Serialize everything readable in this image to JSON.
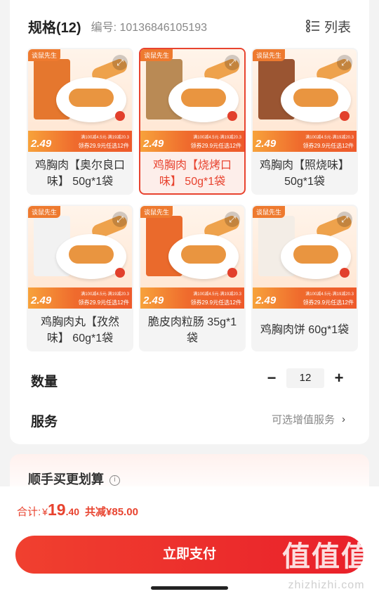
{
  "spec": {
    "title": "规格(12)",
    "code": "编号: 10136846105193",
    "list_label": "列表"
  },
  "skus": [
    {
      "brand": "谈鼠先生",
      "price": "2.49",
      "promo1": "满100减4.5元·满19减20.3",
      "promo2": "领券29.9元任选12件",
      "name": "鸡胸肉【奥尔良口味】 50g*1袋",
      "pack_color": "#e5772e",
      "selected": false
    },
    {
      "brand": "谈鼠先生",
      "price": "2.49",
      "promo1": "满100减4.5元·满19减20.3",
      "promo2": "领券29.9元任选12件",
      "name": "鸡胸肉【烧烤口味】 50g*1袋",
      "pack_color": "#b98a55",
      "selected": true
    },
    {
      "brand": "谈鼠先生",
      "price": "2.49",
      "promo1": "满100减4.5元·满19减20.3",
      "promo2": "领券29.9元任选12件",
      "name": "鸡胸肉【照烧味】 50g*1袋",
      "pack_color": "#9a5532",
      "selected": false
    },
    {
      "brand": "谈鼠先生",
      "price": "2.49",
      "promo1": "满100减4.5元·满19减20.3",
      "promo2": "领券29.9元任选12件",
      "name": "鸡胸肉丸【孜然味】 60g*1袋",
      "pack_color": "#f2f2f2",
      "selected": false
    },
    {
      "brand": "谈鼠先生",
      "price": "2.49",
      "promo1": "满100减4.5元·满19减20.3",
      "promo2": "领券29.9元任选12件",
      "name": "脆皮肉粒肠 35g*1袋",
      "pack_color": "#ea6a2c",
      "selected": false
    },
    {
      "brand": "谈鼠先生",
      "price": "2.49",
      "promo1": "满100减4.5元·满19减20.3",
      "promo2": "领券29.9元任选12件",
      "name": "鸡胸肉饼 60g*1袋",
      "pack_color": "#f3ede6",
      "selected": false
    }
  ],
  "quantity": {
    "label": "数量",
    "value": "12",
    "minus": "−",
    "plus": "+"
  },
  "service": {
    "label": "服务",
    "hint": "可选增值服务",
    "chevron": "›"
  },
  "bundle": {
    "title": "顺手买更划算",
    "info": "i"
  },
  "footer": {
    "total_label": "合计:",
    "currency": "¥",
    "total_int": "19",
    "total_dec": ".40",
    "saved": "共减¥85.00",
    "pay_label": "立即支付"
  },
  "watermark": {
    "big": "值值值",
    "small": "zhizhizhi.com"
  },
  "colors": {
    "accent": "#e8432f",
    "price_bar": "#ef6b2d"
  }
}
